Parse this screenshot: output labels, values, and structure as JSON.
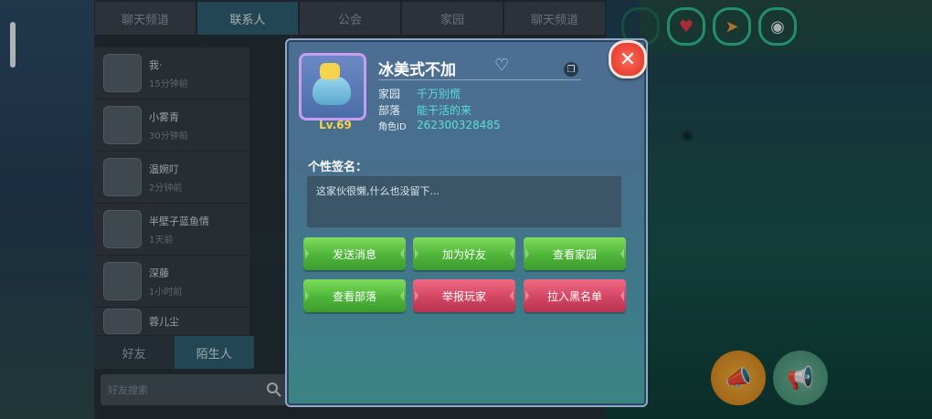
{
  "contact_panel": {
    "tabs": [
      "聊天频道",
      "联系人",
      "公会",
      "家园",
      "聊天频道"
    ],
    "items": [
      {
        "name": "我·",
        "sub": "15分钟前"
      },
      {
        "name": "小雾青",
        "sub": "30分钟前"
      },
      {
        "name": "温婉叮",
        "sub": "2分钟前"
      },
      {
        "name": "半壁子蓝鱼情",
        "sub": "1天前"
      },
      {
        "name": "深藤",
        "sub": "1小时前"
      },
      {
        "name": "蓉儿尘",
        "sub": ""
      }
    ],
    "friend_tabs": {
      "friends": "好友",
      "strangers": "陌生人"
    },
    "search_placeholder": "好友搜索"
  },
  "dialog": {
    "player_name": "冰美式不加",
    "level": "Lv.69",
    "home_label": "家园",
    "home_value": "千万别慌",
    "tribe_label": "部落",
    "tribe_value": "能干活的来",
    "id_label": "角色ID",
    "id_value": "262300328485",
    "signature_label": "个性签名：",
    "signature_text": "这家伙很懒,什么也没留下...",
    "buttons": {
      "send_message": "发送消息",
      "add_friend": "加为好友",
      "view_home": "查看家园",
      "view_tribe": "查看部落",
      "report_player": "举报玩家",
      "blacklist": "拉入黑名单"
    },
    "close_symbol": "✕",
    "gender_symbol": "♡"
  },
  "colors": {
    "accent_value": "#59e0d6",
    "button_green": "#4fb53a",
    "button_pink": "#d34663",
    "level_color": "#f6d44a"
  },
  "icons": [
    "close-icon",
    "copy-icon",
    "heart-icon",
    "eye-icon",
    "megaphone-icon",
    "search-icon"
  ]
}
